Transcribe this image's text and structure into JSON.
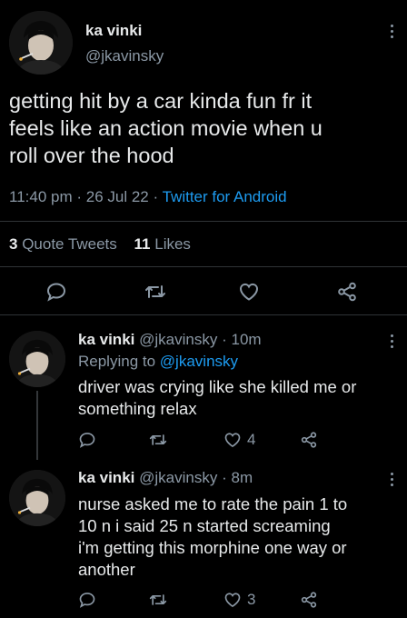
{
  "main_tweet": {
    "author_name": "ka vinki",
    "author_handle": "@jkavinsky",
    "text_line1": "getting hit by a car kinda fun fr it",
    "text_line2": "feels like an action movie when u",
    "text_line3": "roll over the hood",
    "time": "11:40 pm",
    "sep1": "·",
    "date": "26 Jul 22",
    "sep2": "·",
    "source": "Twitter for Android",
    "quote_count": "3",
    "quote_label": "Quote Tweets",
    "like_count": "11",
    "like_label": "Likes"
  },
  "replies": [
    {
      "author_name": "ka vinki",
      "author_handle": "@jkavinsky",
      "sep": "·",
      "time": "10m",
      "replying_prefix": "Replying to",
      "replying_to": "@jkavinsky",
      "text_line1": "driver was crying like she killed me or",
      "text_line2": "something relax",
      "like_count": "4"
    },
    {
      "author_name": "ka vinki",
      "author_handle": "@jkavinsky",
      "sep": "·",
      "time": "8m",
      "text_line1": "nurse asked me to rate the pain 1 to",
      "text_line2": "10 n i said 25 n started screaming",
      "text_line3": "i'm getting this morphine one way or",
      "text_line4": "another",
      "like_count": "3"
    }
  ],
  "icons": [
    "avatar",
    "kebab-icon",
    "reply-icon",
    "retweet-icon",
    "like-icon",
    "share-icon"
  ],
  "colors": {
    "background": "#000000",
    "text": "#e7e9ea",
    "muted": "#8b98a5",
    "link": "#1d9bf0",
    "divider": "#2f3336"
  }
}
